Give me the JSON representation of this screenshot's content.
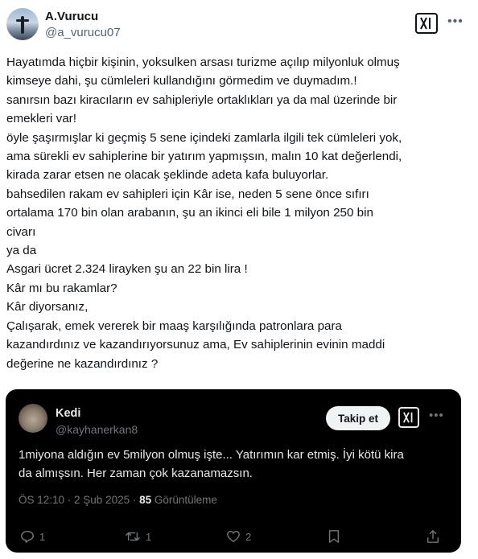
{
  "author": {
    "name": "A.Vurucu",
    "handle": "@a_vurucu07"
  },
  "tweet_lines": [
    "Hayatımda hiçbir kişinin, yoksulken arsası turizme açılıp milyonluk olmuş",
    "kimseye dahi, şu cümleleri kullandığını görmedim ve duymadım.!",
    "sanırsın bazı kiracıların ev sahipleriyle ortaklıkları ya da mal üzerinde bir",
    "emekleri var!",
    "öyle şaşırmışlar ki geçmiş 5 sene içindeki zamlarla ilgili  tek cümleleri yok,",
    "ama sürekli ev sahiplerine bir yatırım yapmışsın, malın 10 kat değerlendi,",
    "kirada zarar etsen ne olacak şeklinde adeta kafa buluyorlar.",
    "bahsedilen rakam ev sahipleri için Kâr ise, neden 5 sene önce sıfırı",
    "ortalama 170 bin olan arabanın, şu an ikinci eli bile 1 milyon 250 bin",
    "civarı",
    "ya da",
    "Asgari ücret 2.324 lirayken şu an 22 bin lira !",
    "Kâr mı bu rakamlar?",
    "Kâr diyorsanız,",
    "Çalışarak, emek vererek bir maaş karşılığında patronlara para",
    "kazandırdınız ve kazandırıyorsunuz ama, Ev sahiplerinin evinin maddi",
    "değerine ne kazandırdınız ?"
  ],
  "quoted": {
    "name": "Kedi",
    "handle": "@kayhanerkan8",
    "follow_label": "Takip et",
    "text_lines": [
      "1miyona aldığın ev 5milyon olmuş işte... Yatırımın kar etmiş. İyi kötü kira",
      "da almışsın. Her zaman çok kazanamazsın."
    ],
    "timestamp": "ÖS 12:10 · 2 Şub 2025 · ",
    "views_count": "85",
    "views_label": " Görüntüleme",
    "replies": "1",
    "reposts": "1",
    "likes": "2"
  },
  "icons": [
    "grok-icon",
    "more-icon",
    "reply-icon",
    "repost-icon",
    "like-icon",
    "bookmark-icon",
    "share-icon"
  ],
  "colors": {
    "text": "#0f1419",
    "secondary": "#536471",
    "quote_bg": "#000000",
    "quote_text": "#e7e9ea",
    "quote_secondary": "#71767b"
  }
}
